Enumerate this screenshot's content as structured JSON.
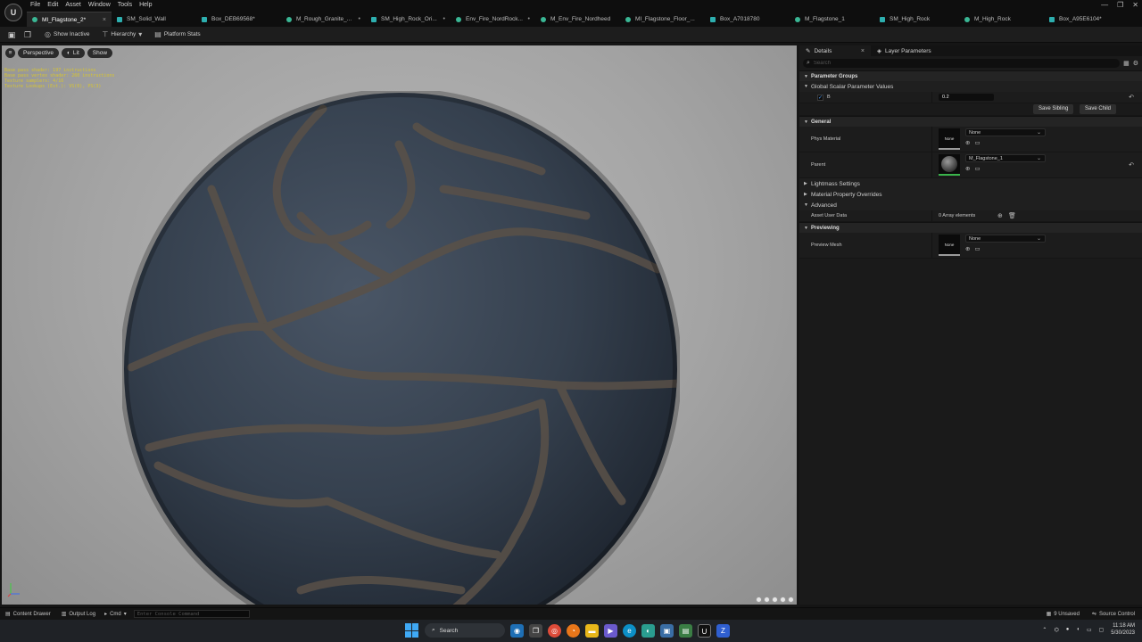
{
  "app": {
    "logo": "U",
    "menu": [
      "File",
      "Edit",
      "Asset",
      "Window",
      "Tools",
      "Help"
    ],
    "window_controls": [
      "—",
      "❐",
      "✕"
    ]
  },
  "tabs": [
    {
      "label": "MI_Flagstone_2*",
      "icon": "material-instance",
      "active": true,
      "close": "×"
    },
    {
      "label": "SM_Solid_Wall",
      "icon": "static-mesh",
      "active": false
    },
    {
      "label": "Box_DEB69568*",
      "icon": "static-mesh",
      "active": false
    },
    {
      "label": "M_Rough_Granite_...",
      "icon": "material-instance",
      "active": false,
      "close": "•"
    },
    {
      "label": "SM_High_Rock_Ori...",
      "icon": "static-mesh",
      "active": false,
      "close": "•"
    },
    {
      "label": "Env_Fire_NordRock...",
      "icon": "material-instance",
      "active": false,
      "close": "•"
    },
    {
      "label": "M_Env_Fire_Nordheed",
      "icon": "material-instance",
      "active": false
    },
    {
      "label": "MI_Flagstone_Floor_...",
      "icon": "material-instance",
      "active": false
    },
    {
      "label": "Box_A7018780",
      "icon": "static-mesh",
      "active": false
    },
    {
      "label": "M_Flagstone_1",
      "icon": "material-instance",
      "active": false
    },
    {
      "label": "SM_High_Rock",
      "icon": "static-mesh",
      "active": false
    },
    {
      "label": "M_High_Rock",
      "icon": "material-instance",
      "active": false
    },
    {
      "label": "Box_A95E6104*",
      "icon": "static-mesh",
      "active": false
    }
  ],
  "toolbar": {
    "show_inactive": "Show Inactive",
    "hierarchy": "Hierarchy",
    "platform_stats": "Platform Stats"
  },
  "viewport": {
    "perspective": "Perspective",
    "lit": "Lit",
    "show": "Show",
    "stats": [
      "Base pass shader: 197 instructions",
      "Base pass vertex shader: 260 instructions",
      "Texture samplers: 4/16",
      "Texture Lookups (Est.): VS(0), PS(3)"
    ]
  },
  "details": {
    "tab_details": "Details",
    "tab_close": "×",
    "tab_layer": "Layer Parameters",
    "search_placeholder": "Search",
    "parameter_groups": "Parameter Groups",
    "global_scalar": "Global Scalar Parameter Values",
    "scalar_name": "B",
    "scalar_value": "0.2",
    "save_sibling": "Save Sibling",
    "save_child": "Save Child",
    "general": "General",
    "phys_material_label": "Phys Material",
    "phys_material_thumb": "None",
    "phys_material_value": "None",
    "parent_label": "Parent",
    "parent_value": "M_Flagstone_1",
    "lightmass": "Lightmass Settings",
    "material_overrides": "Material Property Overrides",
    "advanced": "Advanced",
    "asset_user_data_label": "Asset User Data",
    "asset_user_data_value": "0 Array elements",
    "previewing": "Previewing",
    "preview_mesh_label": "Preview Mesh",
    "preview_mesh_thumb": "None",
    "preview_mesh_value": "None"
  },
  "statusbar": {
    "content_drawer": "Content Drawer",
    "output_log": "Output Log",
    "cmd": "Cmd",
    "console_placeholder": "Enter Console Command",
    "unsaved": "9 Unsaved",
    "source_control": "Source Control"
  },
  "taskbar": {
    "search": "Search",
    "time": "11:18 AM",
    "date": "5/30/2023"
  },
  "colors": {
    "accent_blue": "#3fa9f5",
    "stats_yellow": "#d7c531",
    "tab_teal": "#3ab795"
  }
}
